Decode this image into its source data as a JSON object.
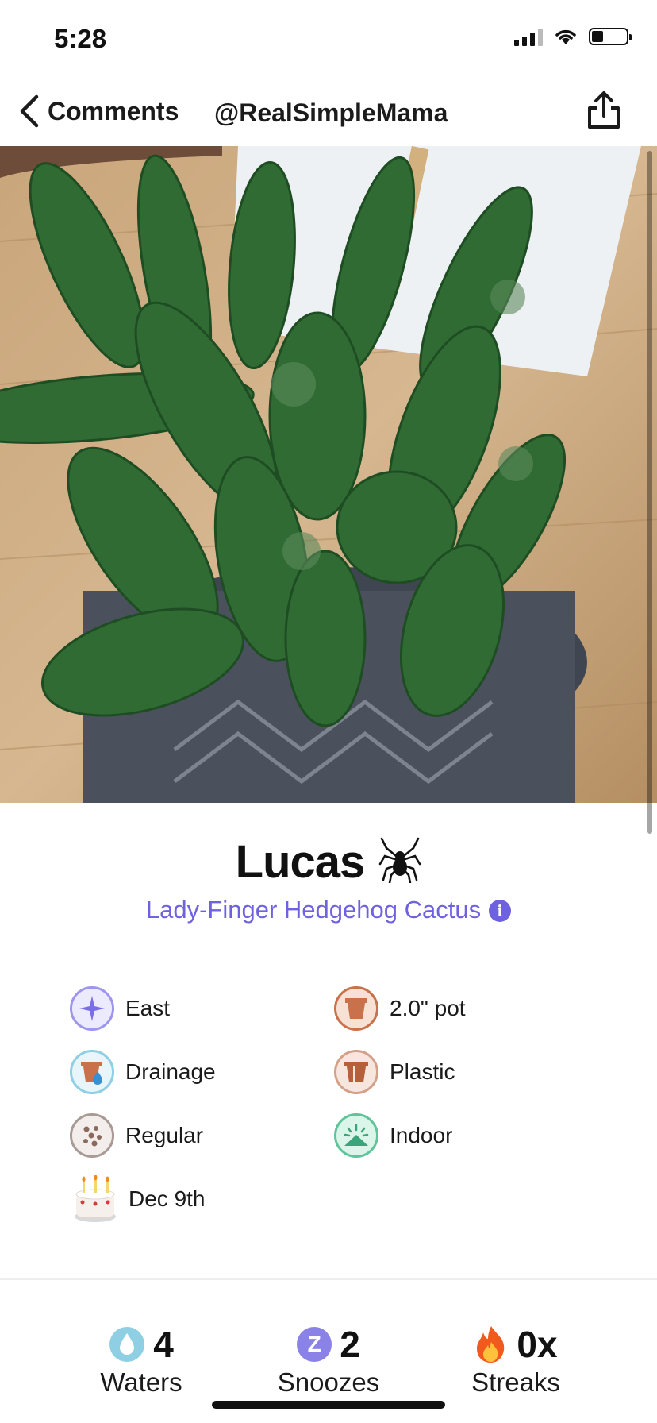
{
  "status_bar": {
    "time": "5:28",
    "battery_level": 0.3
  },
  "nav": {
    "back_label": "Comments",
    "handle": "@RealSimpleMama"
  },
  "plant": {
    "name": "Lucas",
    "species": "Lady-Finger Hedgehog Cactus",
    "info_glyph": "i"
  },
  "attributes": [
    {
      "label": "East",
      "icon": "compass-star-icon"
    },
    {
      "label": "2.0\" pot",
      "icon": "pot-size-icon"
    },
    {
      "label": "Drainage",
      "icon": "drainage-pot-icon"
    },
    {
      "label": "Plastic",
      "icon": "pot-material-icon"
    },
    {
      "label": "Regular",
      "icon": "soil-icon"
    },
    {
      "label": "Indoor",
      "icon": "indoor-sun-icon"
    },
    {
      "label": "Dec 9th",
      "icon": "birthday-cake-icon"
    }
  ],
  "stats": [
    {
      "value": "4",
      "label": "Waters",
      "icon": "water-drop-icon"
    },
    {
      "value": "2",
      "label": "Snoozes",
      "icon": "snooze-icon",
      "icon_text": "Z"
    },
    {
      "value": "0x",
      "label": "Streaks",
      "icon": "fire-icon"
    }
  ],
  "colors": {
    "accent": "#6e62e0",
    "water": "#8ecfe4",
    "terracotta": "#c9714a",
    "mint": "#5ec49b"
  }
}
